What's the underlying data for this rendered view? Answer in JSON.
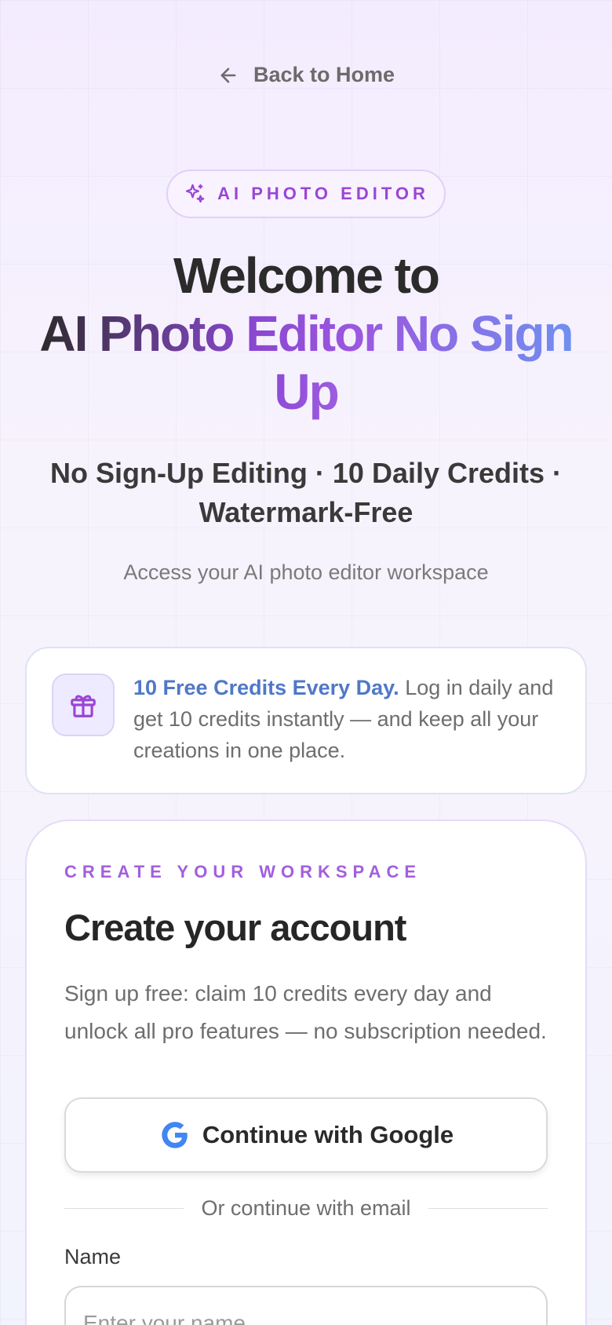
{
  "nav": {
    "back_label": "Back to Home"
  },
  "badge": {
    "label": "AI PHOTO EDITOR"
  },
  "hero": {
    "line1": "Welcome to",
    "line2": "AI Photo Editor No Sign",
    "line3": "Up",
    "subtitle": "No Sign-Up Editing · 10 Daily Credits · Watermark-Free",
    "tagline": "Access your AI photo editor workspace"
  },
  "credits_banner": {
    "headline": "10 Free Credits Every Day.",
    "body": " Log in daily and get 10 credits instantly — and keep all your creations in one place."
  },
  "signup": {
    "eyebrow": "CREATE YOUR WORKSPACE",
    "title": "Create your account",
    "description": "Sign up free: claim 10 credits every day and unlock all pro features — no subscription needed.",
    "google_button": "Continue with Google",
    "divider_text": "Or continue with email",
    "name_label": "Name",
    "name_placeholder": "Enter your name",
    "name_value": ""
  },
  "colors": {
    "accent_purple": "#9b45d6",
    "credits_blue": "#4f78c9",
    "google_blue": "#4285F4"
  },
  "icons": {
    "back": "arrow-left-icon",
    "badge": "sparkles-icon",
    "credits": "gift-icon",
    "google": "google-g-icon"
  }
}
